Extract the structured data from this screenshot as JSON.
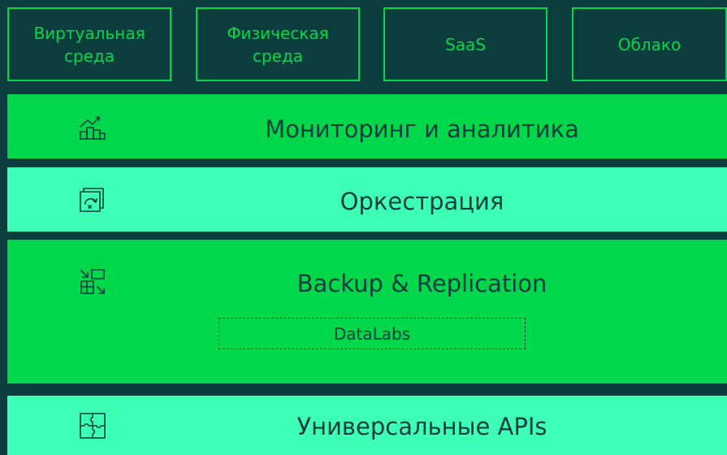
{
  "environments": [
    "Виртуальная\nсреда",
    "Физическая\nсреда",
    "SaaS",
    "Облако"
  ],
  "layers": {
    "monitoring": {
      "label": "Мониторинг и аналитика",
      "icon": "monitoring-chart-icon",
      "color": "#00d74b"
    },
    "orchestration": {
      "label": "Оркестрация",
      "icon": "orchestration-icon",
      "color": "#3dffb6"
    },
    "backup": {
      "label": "Backup & Replication",
      "icon": "backup-replication-icon",
      "color": "#00d74b",
      "sub_label": "DataLabs"
    },
    "apis": {
      "label": "Универсальные APIs",
      "icon": "puzzle-icon",
      "color": "#3dffb6"
    }
  },
  "colors": {
    "background": "#0b3d3c",
    "accent_green": "#00d74b",
    "mint": "#3dffb6"
  }
}
